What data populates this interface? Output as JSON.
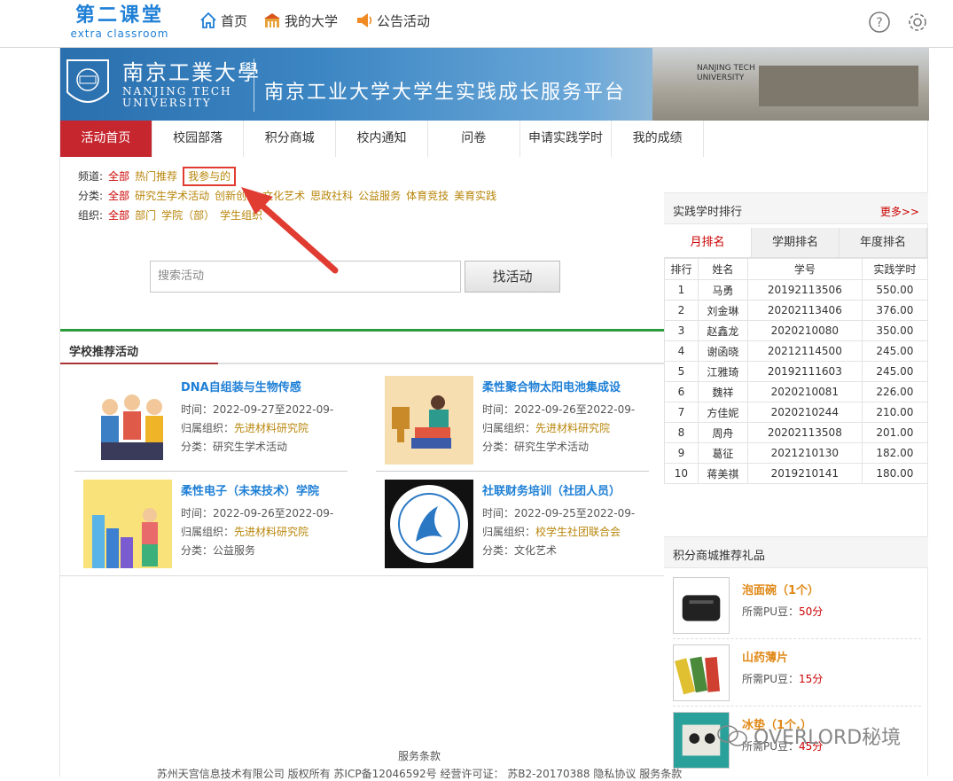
{
  "logo": {
    "cn": "第二课堂",
    "en": "extra classroom"
  },
  "top_nav": [
    {
      "label": "首页",
      "icon": "home-icon"
    },
    {
      "label": "我的大学",
      "icon": "university-icon"
    },
    {
      "label": "公告活动",
      "icon": "megaphone-icon"
    }
  ],
  "banner": {
    "uni_cn": "南京工業大學",
    "uni_en1": "NANJING TECH",
    "uni_en2": "UNIVERSITY",
    "title": "南京工业大学大学生实践成长服务平台",
    "photo_text": "NANJING TECH UNIVERSITY"
  },
  "tabs": [
    "活动首页",
    "校园部落",
    "积分商城",
    "校内通知",
    "问卷",
    "申请实践学时",
    "我的成绩"
  ],
  "filters": {
    "channel_label": "频道:",
    "channel_all": "全部",
    "channel_opts": [
      "热门推荐",
      "我参与的"
    ],
    "category_label": "分类:",
    "category_all": "全部",
    "category_opts": [
      "研究生学术活动",
      "创新创业",
      "文化艺术",
      "思政社科",
      "公益服务",
      "体育竞技",
      "美育实践"
    ],
    "org_label": "组织:",
    "org_all": "全部",
    "org_opts": [
      "部门",
      "学院（部）",
      "学生组织"
    ]
  },
  "search": {
    "placeholder": "搜索活动",
    "button": "找活动"
  },
  "section_title": "学校推荐活动",
  "activities": [
    {
      "title": "DNA自组装与生物传感",
      "time": "时间：2022-09-27至2022-09-",
      "org_label": "归属组织：",
      "org": "先进材料研究院",
      "cat": "分类：研究生学术活动"
    },
    {
      "title": "柔性聚合物太阳电池集成设",
      "time": "时间：2022-09-26至2022-09-",
      "org_label": "归属组织：",
      "org": "先进材料研究院",
      "cat": "分类：研究生学术活动"
    },
    {
      "title": "柔性电子（未来技术）学院",
      "time": "时间：2022-09-26至2022-09-",
      "org_label": "归属组织：",
      "org": "先进材料研究院",
      "cat": "分类：公益服务"
    },
    {
      "title": "社联财务培训（社团人员）",
      "time": "时间：2022-09-25至2022-09-",
      "org_label": "归属组织：",
      "org": "校学生社团联合会",
      "cat": "分类：文化艺术"
    }
  ],
  "ranking": {
    "title": "实践学时排行",
    "more": "更多>>",
    "tabs": [
      "月排名",
      "学期排名",
      "年度排名"
    ],
    "headers": [
      "排行",
      "姓名",
      "学号",
      "实践学时"
    ],
    "rows": [
      [
        "1",
        "马勇",
        "20192113506",
        "550.00"
      ],
      [
        "2",
        "刘金琳",
        "20202113406",
        "376.00"
      ],
      [
        "3",
        "赵鑫龙",
        "2020210080",
        "350.00"
      ],
      [
        "4",
        "谢函晓",
        "20212114500",
        "245.00"
      ],
      [
        "5",
        "江雅琦",
        "20192111603",
        "245.00"
      ],
      [
        "6",
        "魏祥",
        "2020210081",
        "226.00"
      ],
      [
        "7",
        "方佳妮",
        "2020210244",
        "210.00"
      ],
      [
        "8",
        "周舟",
        "20202113508",
        "201.00"
      ],
      [
        "9",
        "葛征",
        "2021210130",
        "182.00"
      ],
      [
        "10",
        "蒋美祺",
        "2019210141",
        "180.00"
      ]
    ]
  },
  "gifts": {
    "title": "积分商城推荐礼品",
    "items": [
      {
        "name": "泡面碗（1个）",
        "price_label": "所需PU豆：",
        "price": "50分"
      },
      {
        "name": "山药薄片",
        "price_label": "所需PU豆：",
        "price": "15分"
      },
      {
        "name": "冰垫（1个.）",
        "price_label": "所需PU豆：",
        "price": "45分"
      }
    ]
  },
  "footer": {
    "line1": "服务条款",
    "line2": "苏州天宫信息技术有限公司 版权所有 苏ICP备12046592号 经营许可证： 苏B2-20170388 隐私协议 服务条款"
  },
  "watermark": "OVERLORD秘境",
  "colors": {
    "accent_red": "#c6262e",
    "link_blue": "#1e7fd6",
    "org_gold": "#b8860b",
    "highlight_red": "#e03c31"
  }
}
